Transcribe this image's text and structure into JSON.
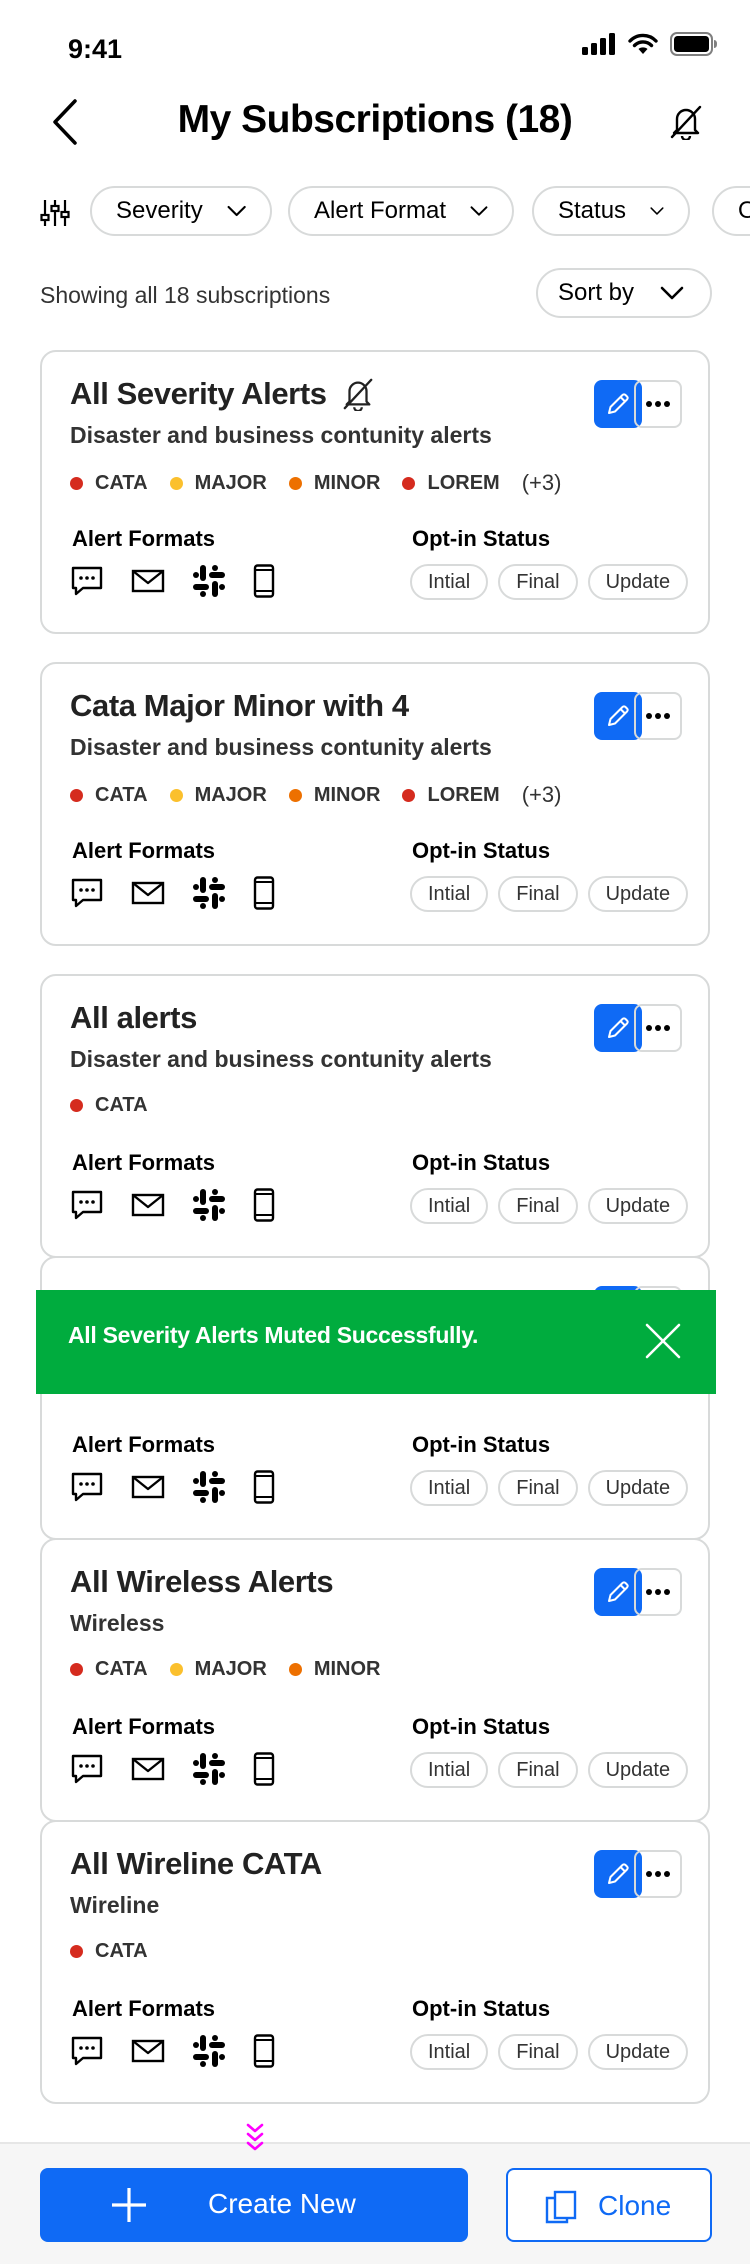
{
  "status_bar": {
    "time": "9:41"
  },
  "header": {
    "title": "My Subscriptions (18)"
  },
  "filters": {
    "chips": [
      {
        "label": "Severity"
      },
      {
        "label": "Alert Format"
      },
      {
        "label": "Status"
      },
      {
        "label": "O"
      }
    ]
  },
  "summary": {
    "text": "Showing all 18 subscriptions",
    "sort_label": "Sort by"
  },
  "labels": {
    "alert_formats": "Alert Formats",
    "optin_status": "Opt-in Status"
  },
  "pills": [
    "Intial",
    "Final",
    "Update"
  ],
  "severity_colors": {
    "CATA": "#d52b1e",
    "MAJOR": "#fbc02d",
    "MINOR": "#ed7000",
    "LOREM": "#d52b1e"
  },
  "cards": [
    {
      "title": "All Severity Alerts",
      "muted": true,
      "subtitle": "Disaster and business contunity alerts",
      "severities": [
        "CATA",
        "MAJOR",
        "MINOR",
        "LOREM"
      ],
      "more": "(+3)"
    },
    {
      "title": "Cata Major Minor with 4",
      "subtitle": "Disaster and business contunity alerts",
      "severities": [
        "CATA",
        "MAJOR",
        "MINOR",
        "LOREM"
      ],
      "more": "(+3)"
    },
    {
      "title": "All alerts",
      "subtitle": "Disaster and business contunity alerts",
      "severities": [
        "CATA"
      ],
      "more": ""
    },
    {
      "title": "",
      "subtitle": "",
      "severities": [],
      "more": ""
    },
    {
      "title": "All Wireless Alerts",
      "subtitle": "Wireless",
      "severities": [
        "CATA",
        "MAJOR",
        "MINOR"
      ],
      "more": ""
    },
    {
      "title": "All Wireline CATA",
      "subtitle": "Wireline",
      "severities": [
        "CATA"
      ],
      "more": ""
    }
  ],
  "toast": {
    "message": "All Severity Alerts Muted Successfully."
  },
  "footer": {
    "create_label": "Create New",
    "clone_label": "Clone"
  },
  "colors": {
    "accent": "#0f6af5",
    "success": "#00ac3e",
    "border": "#d8dada"
  }
}
